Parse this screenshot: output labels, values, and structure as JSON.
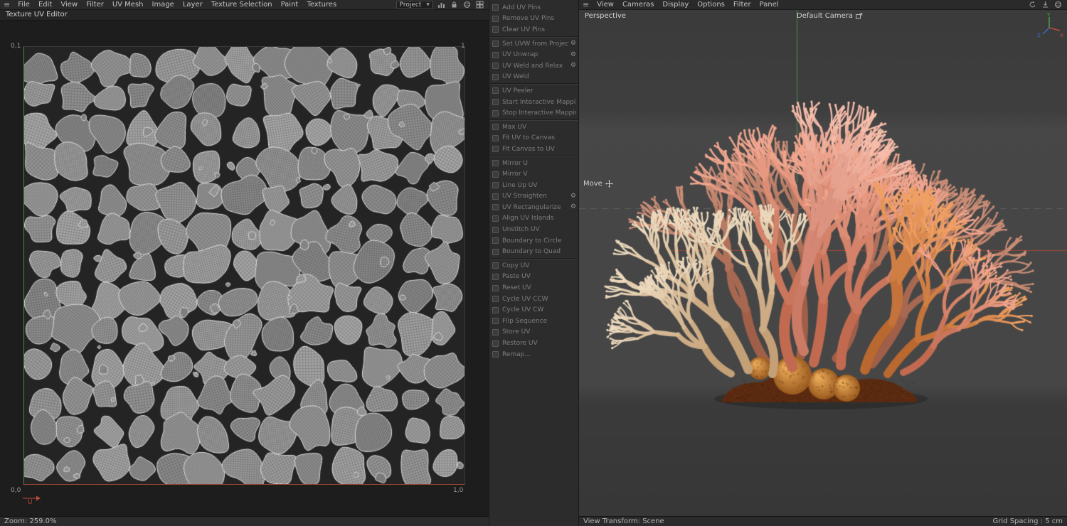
{
  "icons": {
    "menu": "≡",
    "chevron_down": "▼",
    "gear": "⚙"
  },
  "left_panel": {
    "menu_items": [
      "File",
      "Edit",
      "View",
      "Filter",
      "UV Mesh",
      "Image",
      "Layer",
      "Texture Selection",
      "Paint",
      "Textures"
    ],
    "project_dropdown_value": "Project",
    "tab_title": "Texture UV Editor",
    "uv_canvas": {
      "coord_top_left": "0,1",
      "coord_top_right": "1",
      "coord_bottom_left": "0,0",
      "coord_bottom_right": "1,0",
      "axis_u_label": "U",
      "background_color": "#242424",
      "island_fill_color": "#989898",
      "island_stroke_color": "#dadada",
      "island_grid_cols": 13,
      "island_grid_rows": 13
    },
    "status_zoom": "Zoom: 259.0%"
  },
  "commands_panel": {
    "groups": [
      [
        "Add UV Pins",
        "Remove UV Pins",
        "Clear UV Pins"
      ],
      [
        "Set UVW from Projection",
        "UV Unwrap",
        "UV Weld and Relax",
        "UV Weld"
      ],
      [
        "UV Peeler",
        "Start Interactive Mapping",
        "Stop Interactive Mapping"
      ],
      [
        "Max UV",
        "Fit UV to Canvas",
        "Fit Canvas to UV"
      ],
      [
        "Mirror U",
        "Mirror V",
        "Line Up UV",
        "UV Straighten",
        "UV Rectangularize",
        "Align UV Islands",
        "Unstitch UV",
        "Boundary to Circle",
        "Boundary to Quad"
      ],
      [
        "Copy UV",
        "Paste UV",
        "Reset UV",
        "Cycle UV CCW",
        "Cycle UV CW",
        "Flip Sequence",
        "Store UV",
        "Restore UV",
        "Remap..."
      ]
    ],
    "gear_items": [
      "Set UVW from Projection",
      "UV Unwrap",
      "UV Weld and Relax",
      "UV Straighten",
      "UV Rectangularize"
    ]
  },
  "viewport_panel": {
    "menu_items": [
      "View",
      "Cameras",
      "Display",
      "Options",
      "Filter",
      "Panel"
    ],
    "view_label": "Perspective",
    "camera_label": "Default Camera",
    "tool_label": "Move",
    "axis_labels": {
      "x": "X",
      "y": "Y",
      "z": "Z"
    },
    "axis_colors": {
      "x": "#d84a3a",
      "y": "#4fae4f",
      "z": "#3a6fd8"
    },
    "status_left": "View Transform: Scene",
    "status_right": "Grid Spacing : 5 cm",
    "coral_colors": {
      "base_brown": "#5a2a10",
      "bulb_dark": "#9a5a1e",
      "bulb_light": "#e8a858",
      "palettes": [
        [
          "#9f5f48",
          "#c98d76"
        ],
        [
          "#c4a077",
          "#ecd9bd"
        ],
        [
          "#c16a50",
          "#f0a58e"
        ],
        [
          "#cb7a66",
          "#f6bcaa"
        ],
        [
          "#b9682f",
          "#f0a064"
        ]
      ]
    }
  }
}
